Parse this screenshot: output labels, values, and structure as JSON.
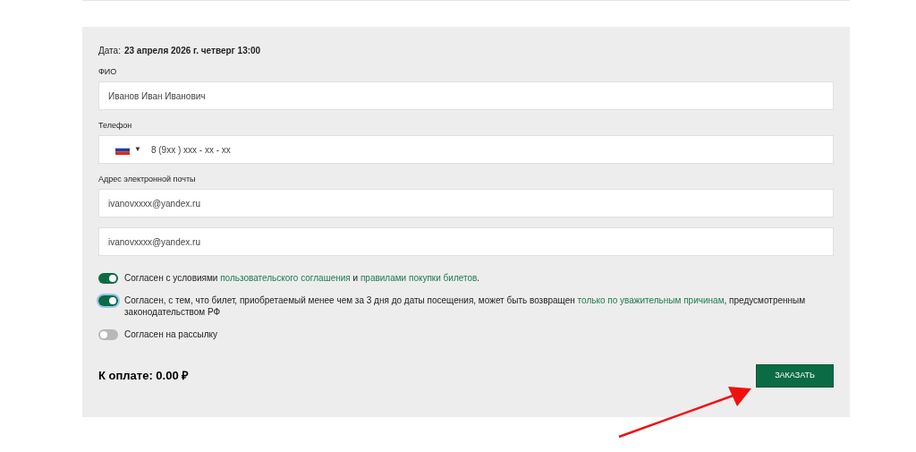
{
  "date": {
    "label": "Дата:",
    "value": "23 апреля 2026 г. четверг 13:00"
  },
  "fields": [
    {
      "label": "ФИО",
      "kind": "text",
      "value": "Иванов Иван Иванович"
    },
    {
      "label": "Телефон",
      "kind": "phone",
      "caret": "▼",
      "value": "8 (9xx ) xxx - xx - xx"
    },
    {
      "label": "Адрес электронной почты",
      "kind": "text",
      "value": "ivanovxxxx@yandex.ru"
    },
    {
      "kind": "text",
      "value": "ivanovxxxx@yandex.ru"
    }
  ],
  "consents": [
    {
      "on": true,
      "focused": false,
      "parts": [
        {
          "kind": "text",
          "text": "Согласен с условиями "
        },
        {
          "kind": "link",
          "text": "пользовательского соглашения"
        },
        {
          "kind": "text",
          "text": " и "
        },
        {
          "kind": "link",
          "text": "правилами покупки билетов"
        },
        {
          "kind": "text",
          "text": "."
        }
      ]
    },
    {
      "on": true,
      "focused": true,
      "parts": [
        {
          "kind": "text",
          "text": "Согласен, с тем, что билет, приобретаемый менее чем за 3 дня до даты посещения, может быть возвращен "
        },
        {
          "kind": "link",
          "text": "только по уважительным причинам"
        },
        {
          "kind": "text",
          "text": ", предусмотренным законодательством РФ"
        }
      ]
    },
    {
      "on": false,
      "focused": false,
      "parts": [
        {
          "kind": "text",
          "text": "Согласен на рассылку"
        }
      ]
    }
  ],
  "total": "К оплате: 0.00 ₽",
  "order_button": "ЗАКАЗАТЬ"
}
